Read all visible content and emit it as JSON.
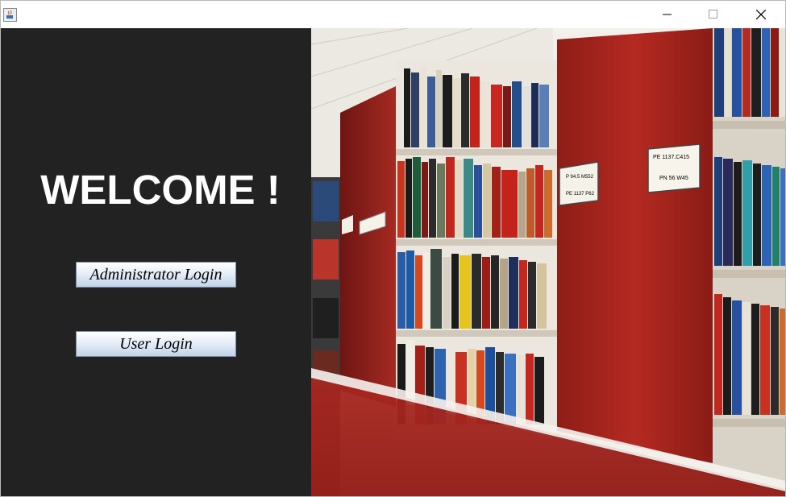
{
  "window": {
    "controls": {
      "minimize": "minimize-icon",
      "maximize": "maximize-icon",
      "close": "close-icon"
    }
  },
  "welcome_text": "WELCOME !",
  "buttons": {
    "admin_label": "Administrator Login",
    "user_label": "User Login"
  },
  "shelf_labels": {
    "label_a": "P 94.5 M552",
    "label_a2": "PE 1137 P62",
    "label_b": "PE 1137.C415",
    "label_b2": "PN 56 W45"
  },
  "colors": {
    "left_panel": "#222222",
    "shelf_red": "#8c1c18",
    "band_red": "#a8231d"
  }
}
